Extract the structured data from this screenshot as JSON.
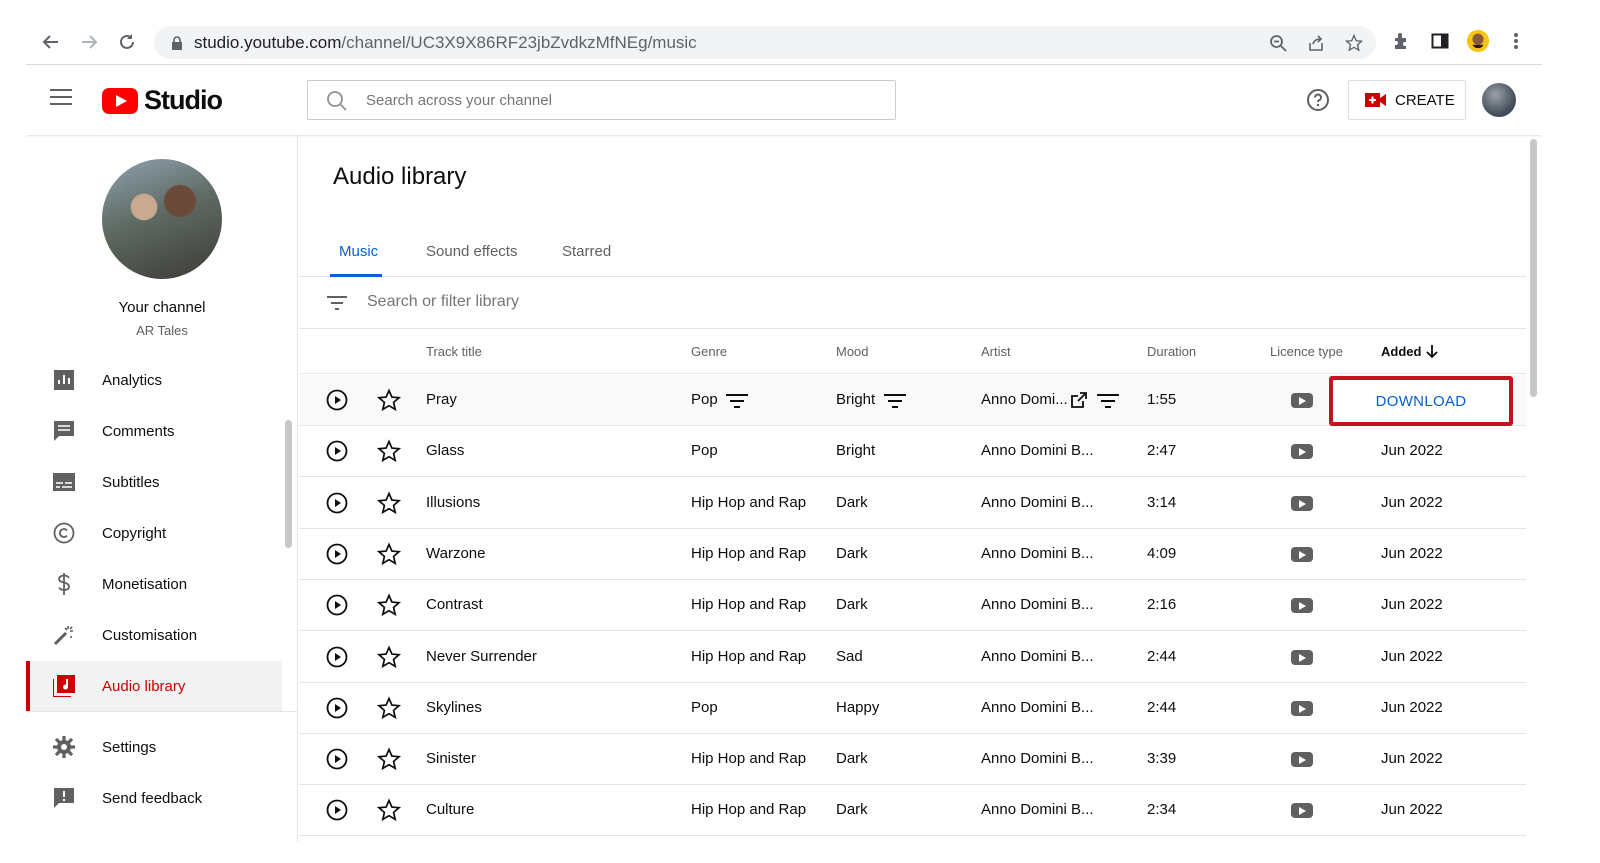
{
  "browser": {
    "url_host": "studio.youtube.com",
    "url_path": "/channel/UC3X9X86RF23jbZvdkzMfNEg/music"
  },
  "header": {
    "logo_text": "Studio",
    "search_placeholder": "Search across your channel",
    "create_label": "CREATE"
  },
  "sidebar": {
    "channel_title": "Your channel",
    "channel_name": "AR Tales",
    "items": [
      {
        "label": "Analytics",
        "icon": "analytics-icon"
      },
      {
        "label": "Comments",
        "icon": "comments-icon"
      },
      {
        "label": "Subtitles",
        "icon": "subtitles-icon"
      },
      {
        "label": "Copyright",
        "icon": "copyright-icon"
      },
      {
        "label": "Monetisation",
        "icon": "dollar-icon"
      },
      {
        "label": "Customisation",
        "icon": "magic-wand-icon"
      },
      {
        "label": "Audio library",
        "icon": "audio-library-icon"
      },
      {
        "label": "Settings",
        "icon": "gear-icon"
      },
      {
        "label": "Send feedback",
        "icon": "feedback-icon"
      }
    ]
  },
  "main": {
    "title": "Audio library",
    "tabs": [
      "Music",
      "Sound effects",
      "Starred"
    ],
    "filter_placeholder": "Search or filter library",
    "columns": {
      "track": "Track title",
      "genre": "Genre",
      "mood": "Mood",
      "artist": "Artist",
      "duration": "Duration",
      "licence": "Licence type",
      "added": "Added"
    },
    "download_label": "DOWNLOAD",
    "rows": [
      {
        "title": "Pray",
        "genre": "Pop",
        "mood": "Bright",
        "artist": "Anno Domi...",
        "duration": "1:55",
        "added": ""
      },
      {
        "title": "Glass",
        "genre": "Pop",
        "mood": "Bright",
        "artist": "Anno Domini B...",
        "duration": "2:47",
        "added": "Jun 2022"
      },
      {
        "title": "Illusions",
        "genre": "Hip Hop and Rap",
        "mood": "Dark",
        "artist": "Anno Domini B...",
        "duration": "3:14",
        "added": "Jun 2022"
      },
      {
        "title": "Warzone",
        "genre": "Hip Hop and Rap",
        "mood": "Dark",
        "artist": "Anno Domini B...",
        "duration": "4:09",
        "added": "Jun 2022"
      },
      {
        "title": "Contrast",
        "genre": "Hip Hop and Rap",
        "mood": "Dark",
        "artist": "Anno Domini B...",
        "duration": "2:16",
        "added": "Jun 2022"
      },
      {
        "title": "Never Surrender",
        "genre": "Hip Hop and Rap",
        "mood": "Sad",
        "artist": "Anno Domini B...",
        "duration": "2:44",
        "added": "Jun 2022"
      },
      {
        "title": "Skylines",
        "genre": "Pop",
        "mood": "Happy",
        "artist": "Anno Domini B...",
        "duration": "2:44",
        "added": "Jun 2022"
      },
      {
        "title": "Sinister",
        "genre": "Hip Hop and Rap",
        "mood": "Dark",
        "artist": "Anno Domini B...",
        "duration": "3:39",
        "added": "Jun 2022"
      },
      {
        "title": "Culture",
        "genre": "Hip Hop and Rap",
        "mood": "Dark",
        "artist": "Anno Domini B...",
        "duration": "2:34",
        "added": "Jun 2022"
      }
    ]
  },
  "colors": {
    "accent_blue": "#065fd4",
    "brand_red": "#ff0000",
    "active_red": "#cc0000",
    "highlight_border": "#c4121f"
  }
}
